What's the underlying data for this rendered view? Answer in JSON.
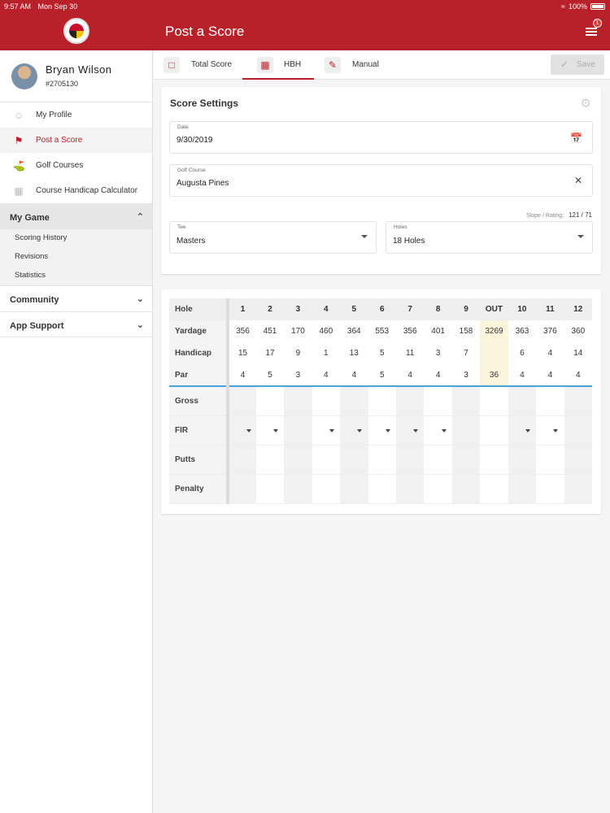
{
  "status": {
    "time": "9:57 AM",
    "date": "Mon Sep 30",
    "battery": "100%"
  },
  "header": {
    "title": "Post a Score",
    "notification_count": "1"
  },
  "user": {
    "name": "Bryan Wilson",
    "id": "#2705130"
  },
  "nav": [
    {
      "label": "My Profile",
      "icon": "profile-icon"
    },
    {
      "label": "Post a Score",
      "icon": "flag-icon"
    },
    {
      "label": "Golf Courses",
      "icon": "golf-pin-icon"
    },
    {
      "label": "Course Handicap Calculator",
      "icon": "grid-icon"
    }
  ],
  "sections": {
    "my_game": {
      "label": "My Game",
      "items": [
        "Scoring History",
        "Revisions",
        "Statistics"
      ]
    },
    "community": {
      "label": "Community"
    },
    "app_support": {
      "label": "App Support"
    }
  },
  "tabs": {
    "total": "Total Score",
    "hbh": "HBH",
    "manual": "Manual",
    "save": "Save"
  },
  "settings": {
    "title": "Score Settings",
    "date_label": "Date",
    "date_value": "9/30/2019",
    "course_label": "Golf Course",
    "course_value": "Augusta Pines",
    "slope_label": "Slope / Rating:",
    "slope_value": "121 / 71",
    "tee_label": "Tee",
    "tee_value": "Masters",
    "holes_label": "Holes",
    "holes_value": "18 Holes"
  },
  "scorecard": {
    "row_labels": {
      "hole": "Hole",
      "yardage": "Yardage",
      "handicap": "Handicap",
      "par": "Par",
      "gross": "Gross",
      "fir": "FIR",
      "putts": "Putts",
      "penalty": "Penalty"
    },
    "holes": [
      "1",
      "2",
      "3",
      "4",
      "5",
      "6",
      "7",
      "8",
      "9",
      "OUT",
      "10",
      "11",
      "12"
    ],
    "yardage": [
      "356",
      "451",
      "170",
      "460",
      "364",
      "553",
      "356",
      "401",
      "158",
      "3269",
      "363",
      "376",
      "360"
    ],
    "handicap": [
      "15",
      "17",
      "9",
      "1",
      "13",
      "5",
      "11",
      "3",
      "7",
      "",
      "6",
      "4",
      "14"
    ],
    "par": [
      "4",
      "5",
      "3",
      "4",
      "4",
      "5",
      "4",
      "4",
      "3",
      "36",
      "4",
      "4",
      "4"
    ]
  },
  "colors": {
    "brand": "#b8202a",
    "out_column": "#fbf5dc",
    "divider": "#4aa3d8"
  }
}
